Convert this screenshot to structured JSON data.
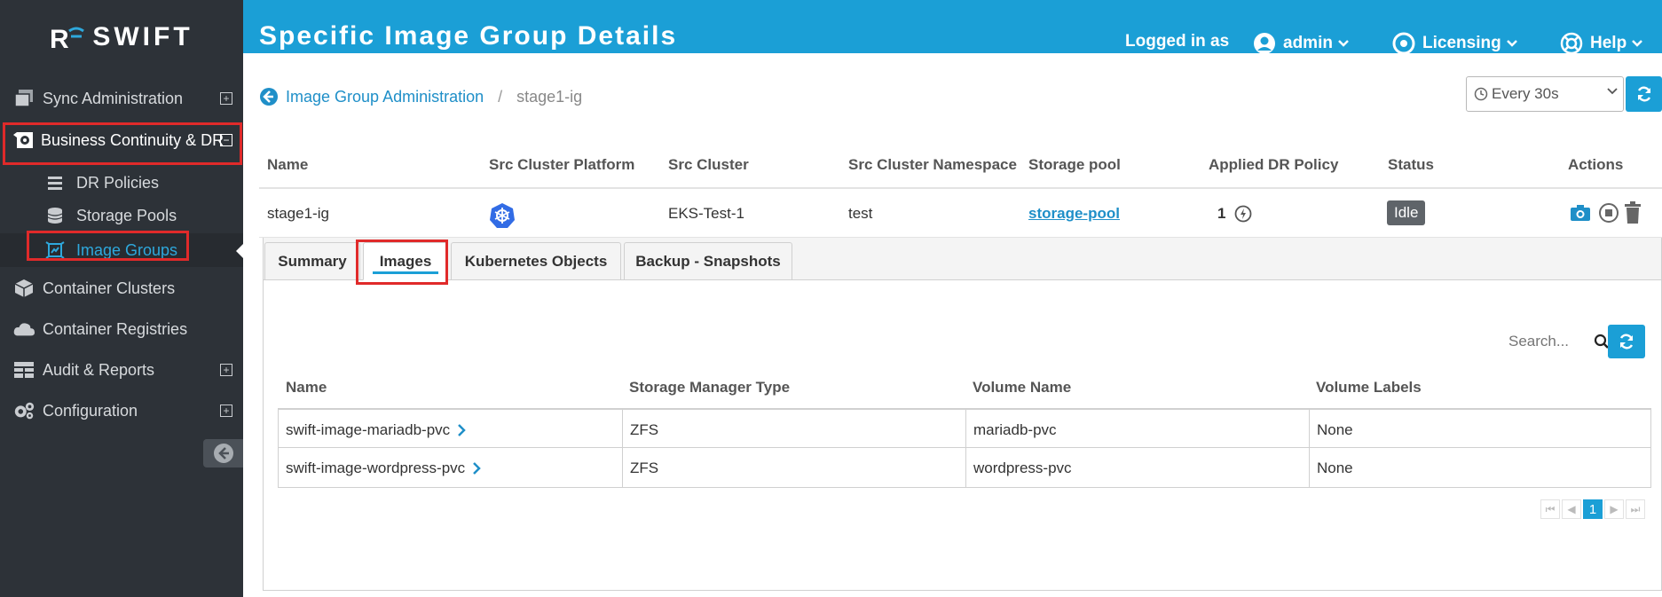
{
  "app": {
    "logo_text": "SWIFT"
  },
  "header": {
    "page_title": "Specific Image Group Details",
    "logged_in_label": "Logged in as",
    "user": "admin",
    "licensing": "Licensing",
    "help": "Help"
  },
  "sidebar": {
    "items": [
      {
        "label": "Sync Administration",
        "icon": "layers-icon"
      },
      {
        "label": "Business Continuity & DR",
        "icon": "dr-icon"
      },
      {
        "label": "DR Policies",
        "icon": "list-icon"
      },
      {
        "label": "Storage Pools",
        "icon": "database-icon"
      },
      {
        "label": "Image Groups",
        "icon": "image-group-icon"
      },
      {
        "label": "Container Clusters",
        "icon": "cube-icon"
      },
      {
        "label": "Container Registries",
        "icon": "cloud-icon"
      },
      {
        "label": "Audit & Reports",
        "icon": "table-icon"
      },
      {
        "label": "Configuration",
        "icon": "gears-icon"
      }
    ]
  },
  "breadcrumb": {
    "parent": "Image Group Administration",
    "separator": "/",
    "current": "stage1-ig"
  },
  "refresh": {
    "interval": "Every 30s"
  },
  "main_table": {
    "headers": [
      "Name",
      "Src Cluster Platform",
      "Src Cluster",
      "Src Cluster Namespace",
      "Storage pool",
      "Applied DR Policy",
      "Status",
      "Actions"
    ],
    "row": {
      "name": "stage1-ig",
      "platform_icon": "kubernetes-icon",
      "src_cluster": "EKS-Test-1",
      "namespace": "test",
      "storage_pool": "storage-pool",
      "applied_dr_policy": "1",
      "status": "Idle"
    }
  },
  "tabs": [
    "Summary",
    "Images",
    "Kubernetes Objects",
    "Backup - Snapshots"
  ],
  "images_grid": {
    "search_placeholder": "Search...",
    "headers": [
      "Name",
      "Storage Manager Type",
      "Volume Name",
      "Volume Labels"
    ],
    "rows": [
      {
        "name": "swift-image-mariadb-pvc",
        "type": "ZFS",
        "volume": "mariadb-pvc",
        "labels": "None"
      },
      {
        "name": "swift-image-wordpress-pvc",
        "type": "ZFS",
        "volume": "wordpress-pvc",
        "labels": "None"
      }
    ],
    "current_page": "1"
  },
  "colors": {
    "header": "#1b9fd6",
    "sidebar": "#2d3238",
    "highlight": "#e02a2a",
    "link": "#1f8fc8"
  }
}
